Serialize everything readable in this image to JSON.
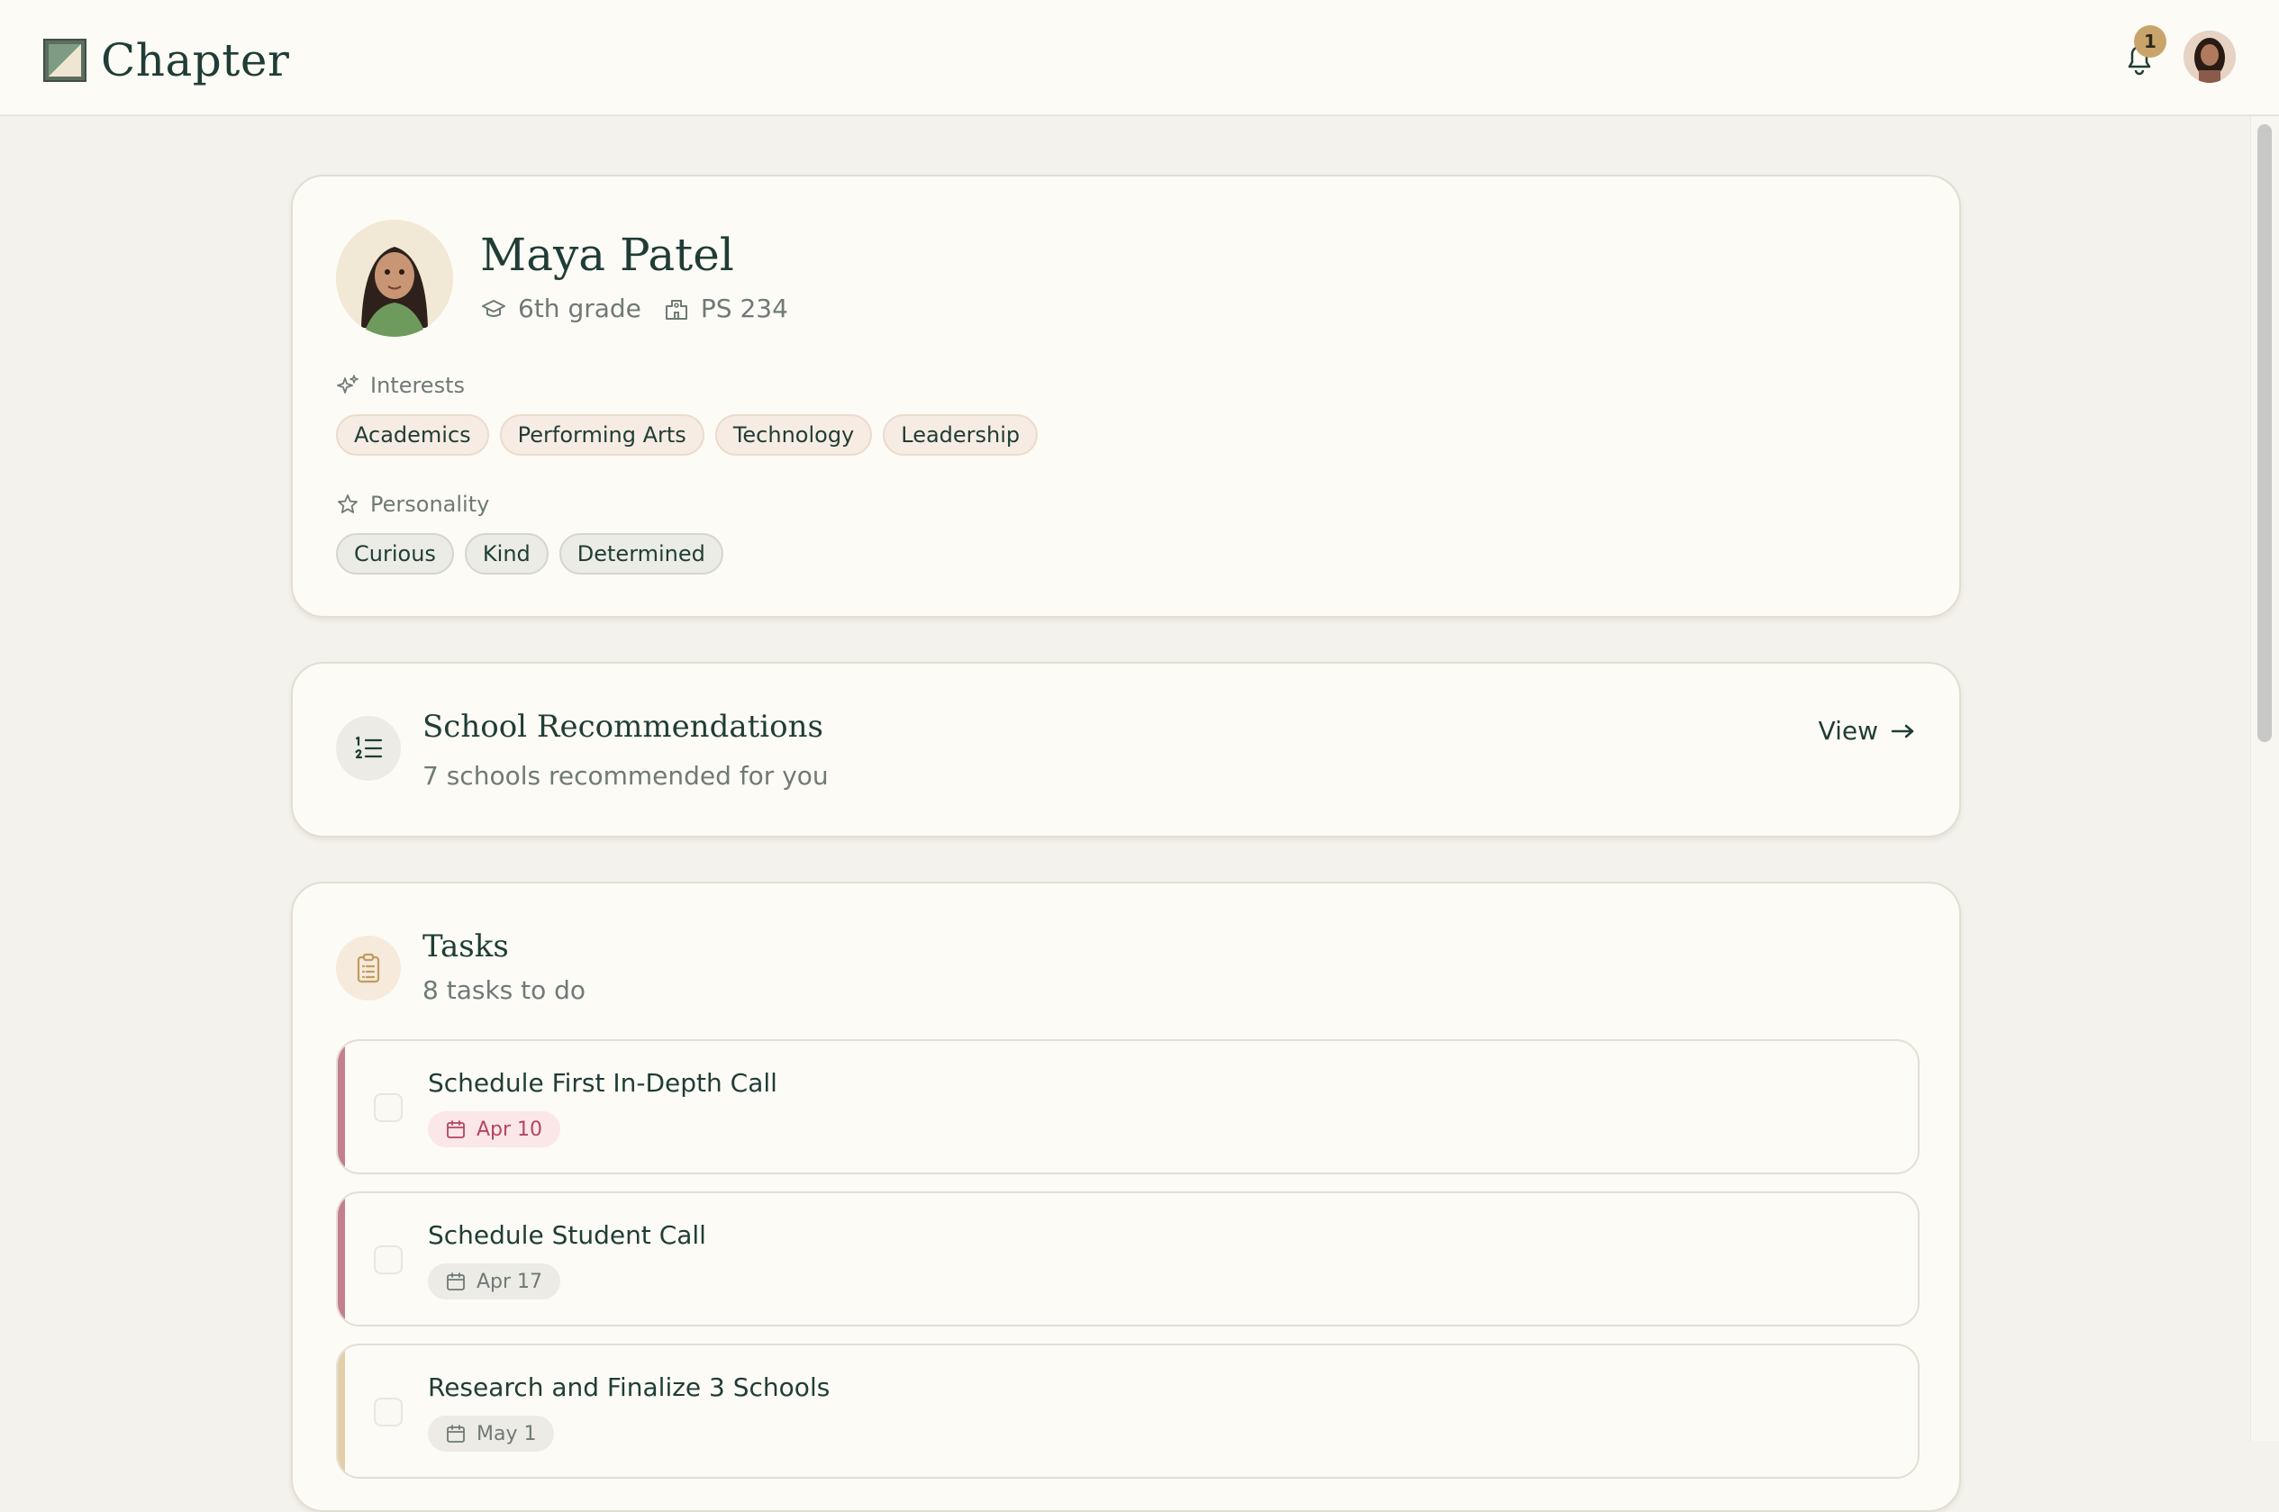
{
  "app": {
    "name": "Chapter",
    "notification_count": "1"
  },
  "student": {
    "name": "Maya Patel",
    "grade": "6th grade",
    "school": "PS 234",
    "interests_label": "Interests",
    "interests": [
      "Academics",
      "Performing Arts",
      "Technology",
      "Leadership"
    ],
    "personality_label": "Personality",
    "personality": [
      "Curious",
      "Kind",
      "Determined"
    ]
  },
  "recommendations": {
    "title": "School Recommendations",
    "subtitle": "7 schools recommended for you",
    "view_label": "View"
  },
  "tasks": {
    "title": "Tasks",
    "subtitle": "8 tasks to do",
    "items": [
      {
        "title": "Schedule First In-Depth Call",
        "due": "Apr 10",
        "accent": "#c47f8f",
        "due_color": "#b3465e",
        "due_bg": "#fbe6e8"
      },
      {
        "title": "Schedule Student Call",
        "due": "Apr 17",
        "accent": "#c47f8f",
        "due_color": "#6e7a76",
        "due_bg": "#ecebe5"
      },
      {
        "title": "Research and Finalize 3 Schools",
        "due": "May 1",
        "accent": "#e2cfaa",
        "due_color": "#6e7a76",
        "due_bg": "#ecebe5"
      }
    ]
  },
  "colors": {
    "brand": "#1f3d36",
    "badge": "#c9a46a",
    "background": "#f4f2ec"
  }
}
